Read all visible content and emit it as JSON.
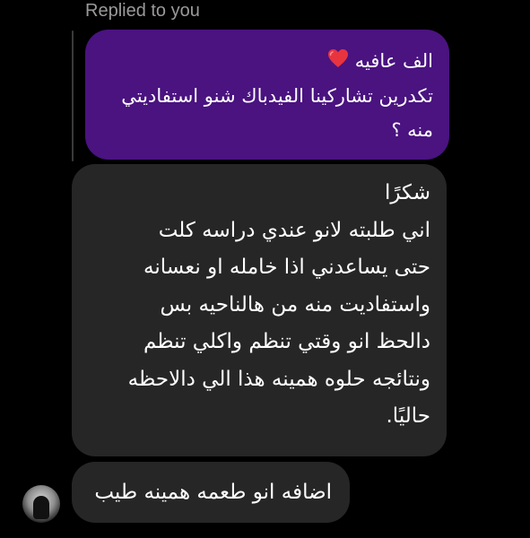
{
  "header": {
    "replied_label": "Replied to you"
  },
  "quoted_message": {
    "lines": [
      "الف عافيه",
      "تكدرين تشاركينا الفيدباك شنو استفاديتي",
      "منه ؟"
    ],
    "emoji_icon": "red-heart",
    "background_color": "#4a1380"
  },
  "messages": [
    {
      "lines": [
        "شكرًا",
        "اني  طلبته لانو عندي دراسه كلت",
        "حتى  يساعدني  اذا خامله او نعسانه",
        "واستفاديت منه من هالناحيه  بس",
        "دالحظ انو وقتي تنظم واكلي تنظم",
        "ونتائجه حلوه همينه هذا الي دالاحظه",
        "حاليًا."
      ]
    },
    {
      "text": "اضافه انو طعمه همينه طيب"
    }
  ],
  "colors": {
    "background": "#000000",
    "incoming_bubble": "#262626",
    "label_gray": "#9a9a9a"
  }
}
